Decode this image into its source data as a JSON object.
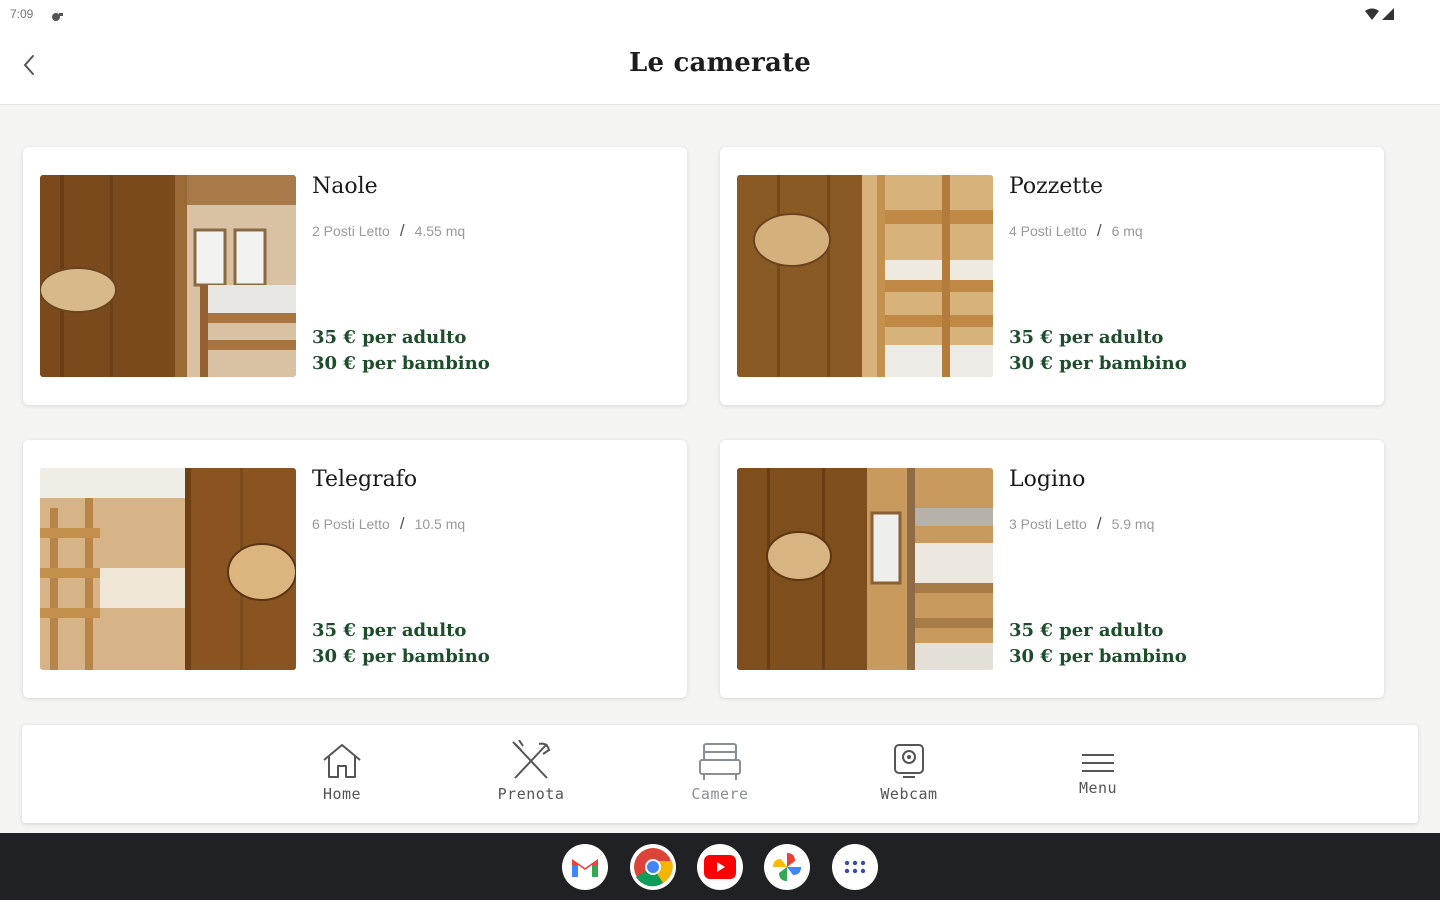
{
  "status_bar": {
    "time": "7:09"
  },
  "header": {
    "title": "Le camerate"
  },
  "rooms": [
    {
      "name": "Naole",
      "beds": "2 Posti Letto",
      "separator": "/",
      "area": "4.55 mq",
      "price_adult": "35 € per adulto",
      "price_child": "30 € per bambino"
    },
    {
      "name": "Pozzette",
      "beds": "4 Posti Letto",
      "separator": "/",
      "area": "6 mq",
      "price_adult": "35 € per adulto",
      "price_child": "30 € per bambino"
    },
    {
      "name": "Telegrafo",
      "beds": "6 Posti Letto",
      "separator": "/",
      "area": "10.5 mq",
      "price_adult": "35 € per adulto",
      "price_child": "30 € per bambino"
    },
    {
      "name": "Logino",
      "beds": "3 Posti Letto",
      "separator": "/",
      "area": "5.9 mq",
      "price_adult": "35 € per adulto",
      "price_child": "30 € per bambino"
    }
  ],
  "bottom_nav": {
    "items": [
      {
        "label": "Home",
        "icon": "home-icon"
      },
      {
        "label": "Prenota",
        "icon": "cutlery-icon"
      },
      {
        "label": "Camere",
        "icon": "bed-icon"
      },
      {
        "label": "Webcam",
        "icon": "webcam-icon"
      },
      {
        "label": "Menu",
        "icon": "hamburger-menu-icon"
      }
    ]
  },
  "taskbar": {
    "apps": [
      "gmail-icon",
      "chrome-icon",
      "youtube-icon",
      "photos-icon",
      "app-drawer-icon"
    ]
  },
  "colors": {
    "price_text": "#1e4d2b",
    "background": "#f4f4f2",
    "taskbar": "#202124"
  }
}
